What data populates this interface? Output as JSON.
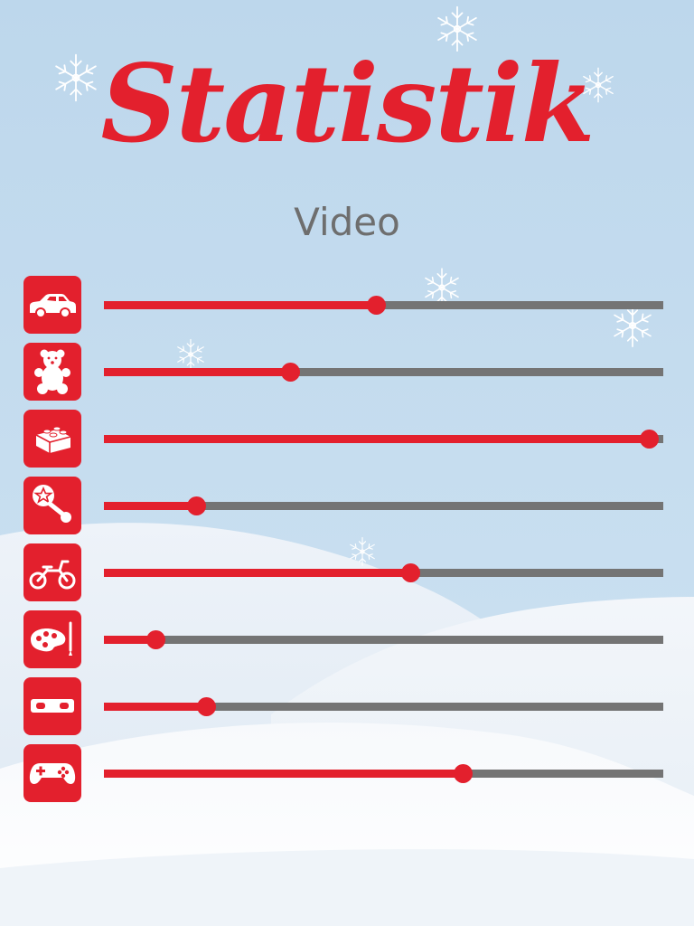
{
  "header": {
    "title": "Statistik",
    "subtitle": "Video"
  },
  "colors": {
    "accent": "#e3202d",
    "track": "#747474",
    "subtitle": "#6e6e6e",
    "sky": "#c3dbee",
    "snow": "#f4f7fb"
  },
  "stats": [
    {
      "icon": "car-icon",
      "value": 0.487
    },
    {
      "icon": "teddy-bear-icon",
      "value": 0.333
    },
    {
      "icon": "building-block-icon",
      "value": 0.974
    },
    {
      "icon": "rattle-icon",
      "value": 0.165
    },
    {
      "icon": "balance-bike-icon",
      "value": 0.548
    },
    {
      "icon": "paint-palette-icon",
      "value": 0.092
    },
    {
      "icon": "toy-block-icon",
      "value": 0.183
    },
    {
      "icon": "gamepad-icon",
      "value": 0.641
    }
  ]
}
